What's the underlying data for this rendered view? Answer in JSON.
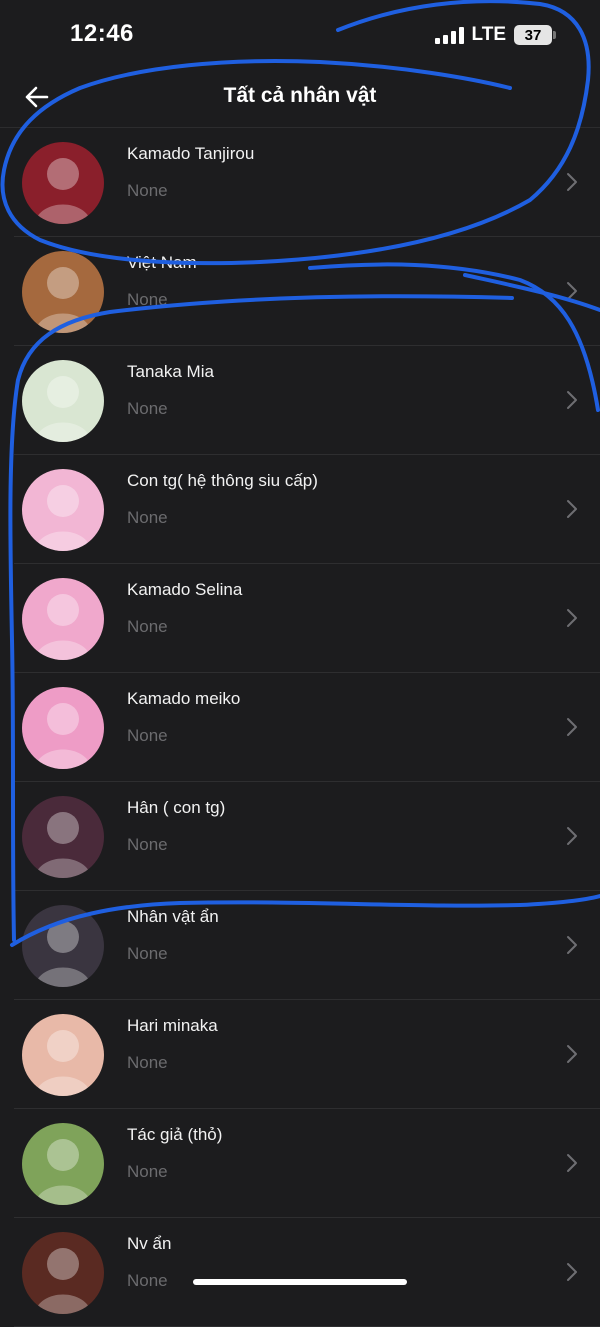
{
  "status_bar": {
    "time": "12:46",
    "network": "LTE",
    "battery": "37"
  },
  "header": {
    "title": "Tất cả nhân vật",
    "back_icon": "arrow-left-icon"
  },
  "characters": [
    {
      "name": "Kamado Tanjirou",
      "desc": "None",
      "avatar_color": "#8a1f2b"
    },
    {
      "name": "Việt Nam",
      "desc": "None",
      "avatar_color": "#a5693e"
    },
    {
      "name": "Tanaka Mia",
      "desc": "None",
      "avatar_color": "#d9e6d2"
    },
    {
      "name": "Con tg( hệ thông siu cấp)",
      "desc": "None",
      "avatar_color": "#f2b6d4"
    },
    {
      "name": "Kamado Selina",
      "desc": "None",
      "avatar_color": "#f0a8cc"
    },
    {
      "name": "Kamado meiko",
      "desc": "None",
      "avatar_color": "#ee9cc6"
    },
    {
      "name": "Hân ( con tg)",
      "desc": "None",
      "avatar_color": "#4a2a3a"
    },
    {
      "name": "Nhân vật ẩn",
      "desc": "None",
      "avatar_color": "#3a3540"
    },
    {
      "name": "Hari minaka",
      "desc": "None",
      "avatar_color": "#e8b9a8"
    },
    {
      "name": "Tác giả (thỏ)",
      "desc": "None",
      "avatar_color": "#7fa35a"
    },
    {
      "name": "Nv ẩn",
      "desc": "None",
      "avatar_color": "#5a2a22"
    }
  ],
  "colors": {
    "background": "#1c1c1e",
    "scribble": "#1f5fe0",
    "secondary_text": "#6b6b6e"
  }
}
